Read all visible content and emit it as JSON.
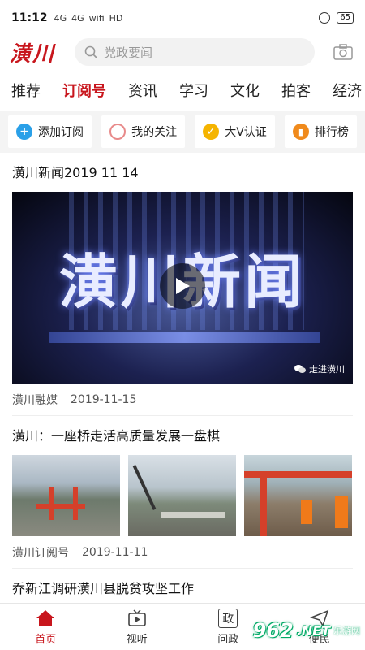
{
  "status": {
    "time": "11:12",
    "signals": [
      "4G",
      "4G",
      "wifi",
      "HD"
    ],
    "battery": "65"
  },
  "header": {
    "logo": "潢川",
    "search_placeholder": "党政要闻"
  },
  "tabs": [
    {
      "label": "推荐",
      "active": false
    },
    {
      "label": "订阅号",
      "active": true
    },
    {
      "label": "资讯",
      "active": false
    },
    {
      "label": "学习",
      "active": false
    },
    {
      "label": "文化",
      "active": false
    },
    {
      "label": "拍客",
      "active": false
    },
    {
      "label": "经济",
      "active": false
    }
  ],
  "quick_actions": [
    {
      "label": "添加订阅",
      "icon": "plus-icon",
      "color": "#2aa0e8"
    },
    {
      "label": "我的关注",
      "icon": "circle-icon",
      "color": "#e88a8a"
    },
    {
      "label": "大V认证",
      "icon": "check-badge-icon",
      "color": "#f5b400"
    },
    {
      "label": "排行榜",
      "icon": "ranking-icon",
      "color": "#f08a1c"
    }
  ],
  "articles": [
    {
      "title": "潢川新闻2019 11 14",
      "video_text": "潢川新闻",
      "video_watermark": "走进潢川",
      "source": "潢川融媒",
      "date": "2019-11-15"
    },
    {
      "title": "潢川：一座桥走活高质量发展一盘棋",
      "source": "潢川订阅号",
      "date": "2019-11-11"
    },
    {
      "title": "乔新江调研潢川县脱贫攻坚工作"
    }
  ],
  "tabbar": [
    {
      "label": "首页",
      "icon": "home-icon",
      "active": true
    },
    {
      "label": "视听",
      "icon": "tv-icon",
      "active": false
    },
    {
      "label": "问政",
      "icon": "zheng-icon",
      "glyph": "政",
      "active": false
    },
    {
      "label": "便民",
      "icon": "plane-icon",
      "active": false
    }
  ],
  "watermark": {
    "number": "962",
    "suffix": ".NET",
    "sub": "乐游网"
  },
  "colors": {
    "brand": "#c8161d",
    "background_quick": "#f4f4f4"
  }
}
